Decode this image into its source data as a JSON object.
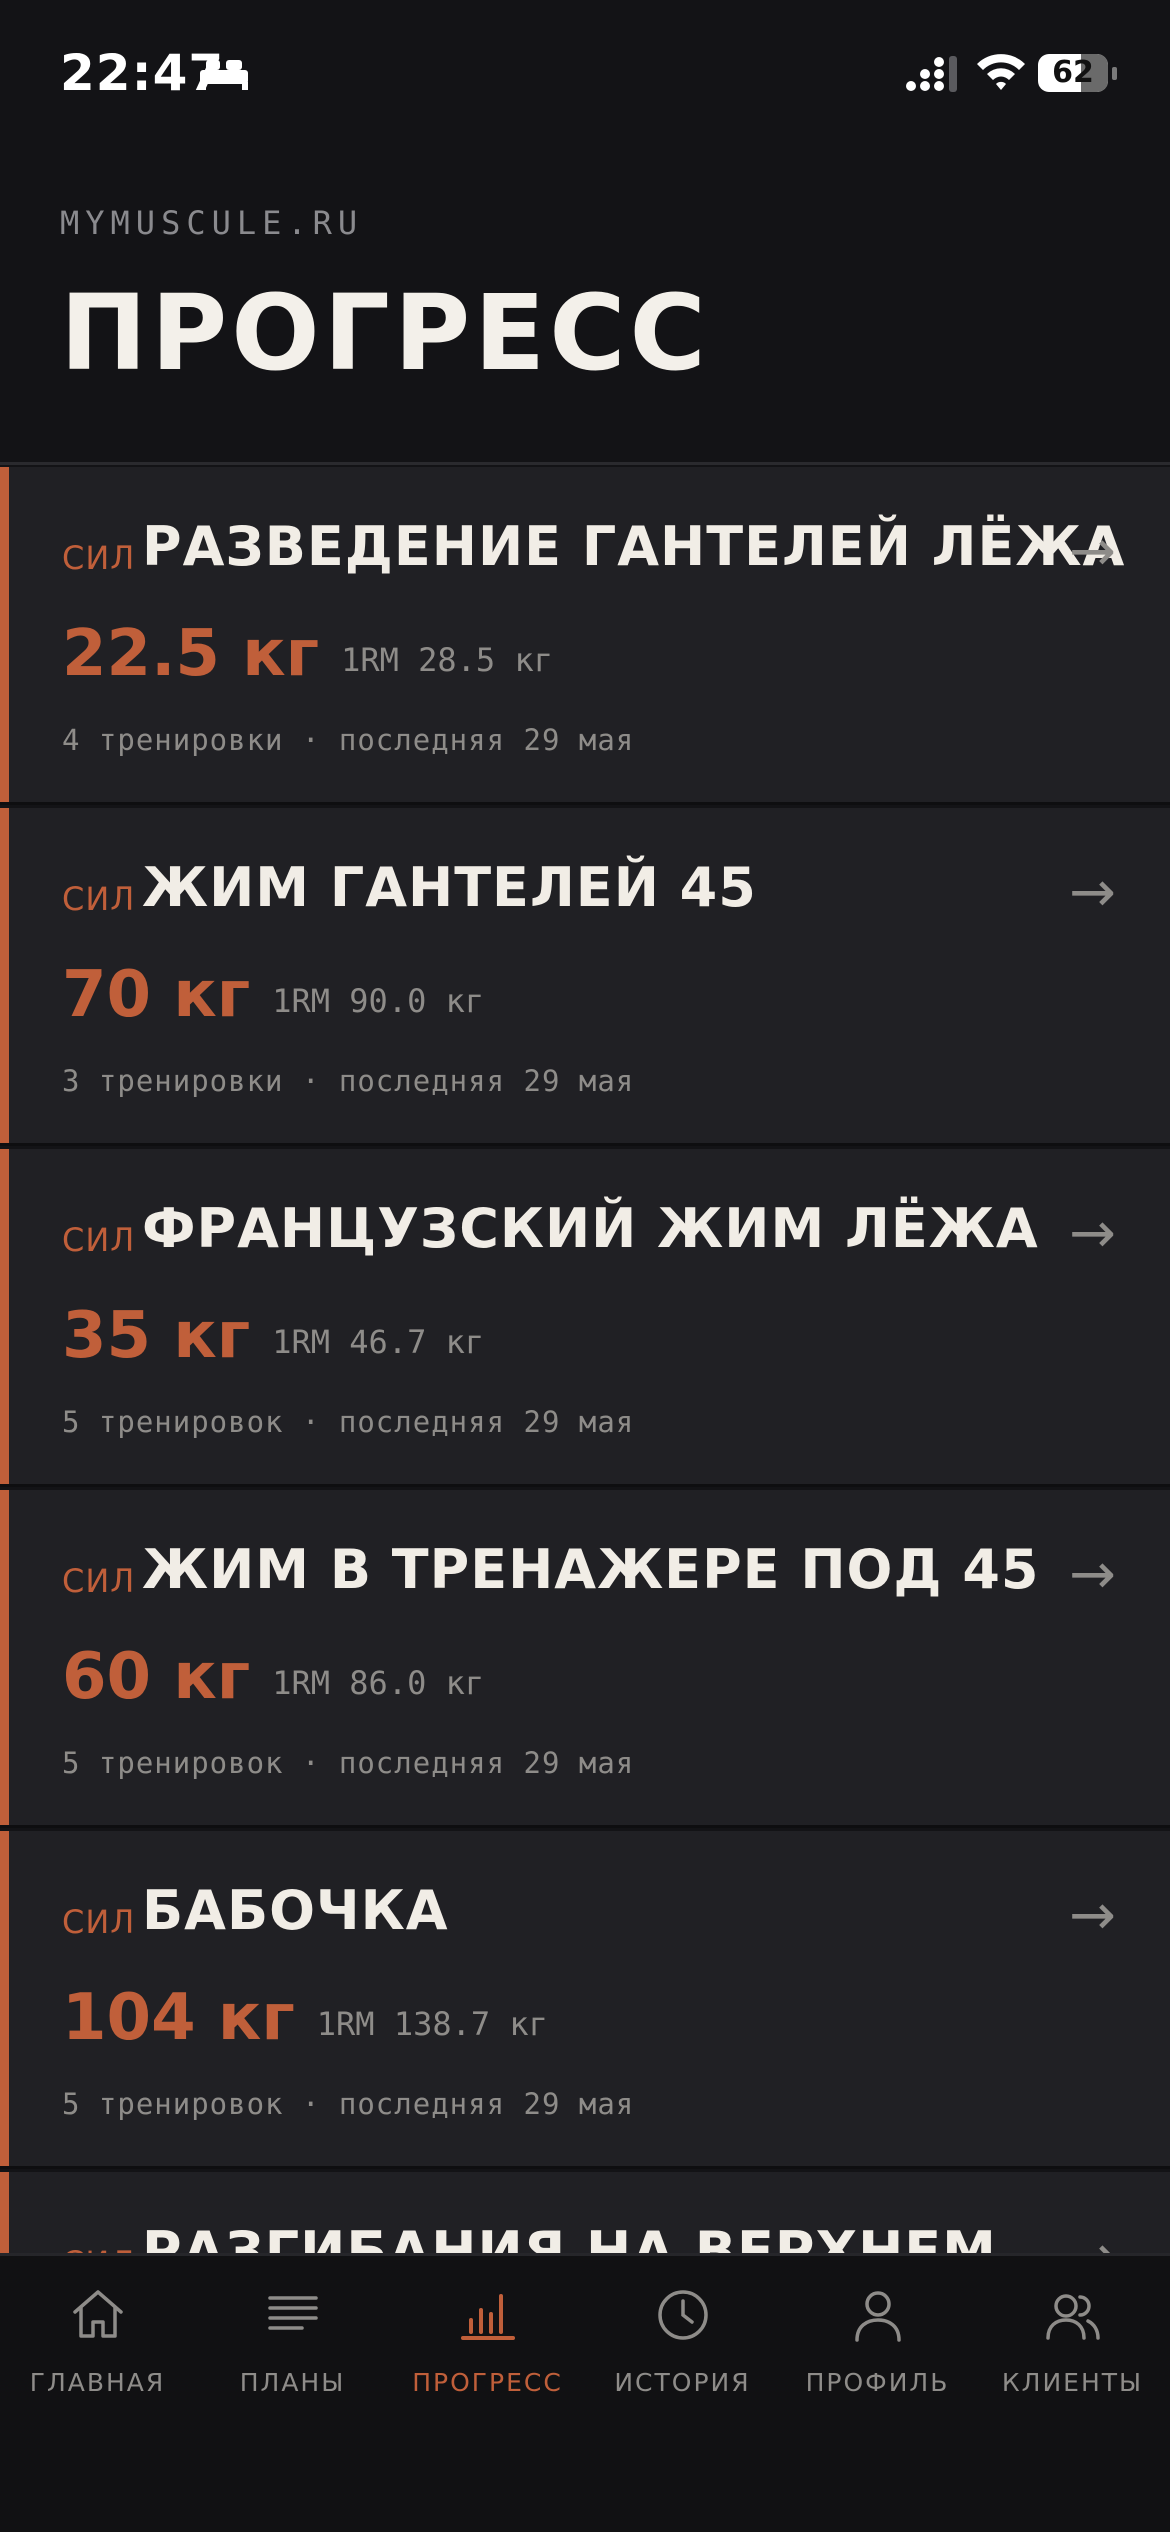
{
  "status_bar": {
    "time": "22:47",
    "battery": "62",
    "battery_level": 0.62
  },
  "header": {
    "brand": "MYMUSCULE.RU",
    "title": "ПРОГРЕСС"
  },
  "colors": {
    "accent": "#c05f3a",
    "background": "#131316",
    "card": "#202024",
    "muted": "#8e8c89"
  },
  "exercises": [
    {
      "tag": "СИЛ",
      "name": "РАЗВЕДЕНИЕ ГАНТЕЛЕЙ ЛЁЖА",
      "weight": "22.5 кг",
      "rm": "1RM 28.5 кг",
      "meta": "4 тренировки · последняя 29 мая"
    },
    {
      "tag": "СИЛ",
      "name": "ЖИМ ГАНТЕЛЕЙ 45",
      "weight": "70 кг",
      "rm": "1RM 90.0 кг",
      "meta": "3 тренировки · последняя 29 мая"
    },
    {
      "tag": "СИЛ",
      "name": "ФРАНЦУЗСКИЙ ЖИМ ЛЁЖА",
      "weight": "35 кг",
      "rm": "1RM 46.7 кг",
      "meta": "5 тренировок · последняя 29 мая"
    },
    {
      "tag": "СИЛ",
      "name": "ЖИМ В ТРЕНАЖЕРЕ ПОД 45",
      "weight": "60 кг",
      "rm": "1RM 86.0 кг",
      "meta": "5 тренировок · последняя 29 мая"
    },
    {
      "tag": "СИЛ",
      "name": "БАБОЧКА",
      "weight": "104 кг",
      "rm": "1RM 138.7 кг",
      "meta": "5 тренировок · последняя 29 мая"
    },
    {
      "tag": "СИЛ",
      "name": "РАЗГИБАНИЯ НА ВЕРХНЕМ",
      "weight": "",
      "rm": "",
      "meta": ""
    }
  ],
  "arrow_glyph": "→",
  "tabs": [
    {
      "label": "ГЛАВНАЯ",
      "icon": "home-icon"
    },
    {
      "label": "ПЛАНЫ",
      "icon": "list-icon"
    },
    {
      "label": "ПРОГРЕСС",
      "icon": "bar-chart-icon",
      "active": true
    },
    {
      "label": "ИСТОРИЯ",
      "icon": "clock-icon"
    },
    {
      "label": "ПРОФИЛЬ",
      "icon": "user-icon"
    },
    {
      "label": "КЛИЕНТЫ",
      "icon": "users-icon"
    }
  ]
}
